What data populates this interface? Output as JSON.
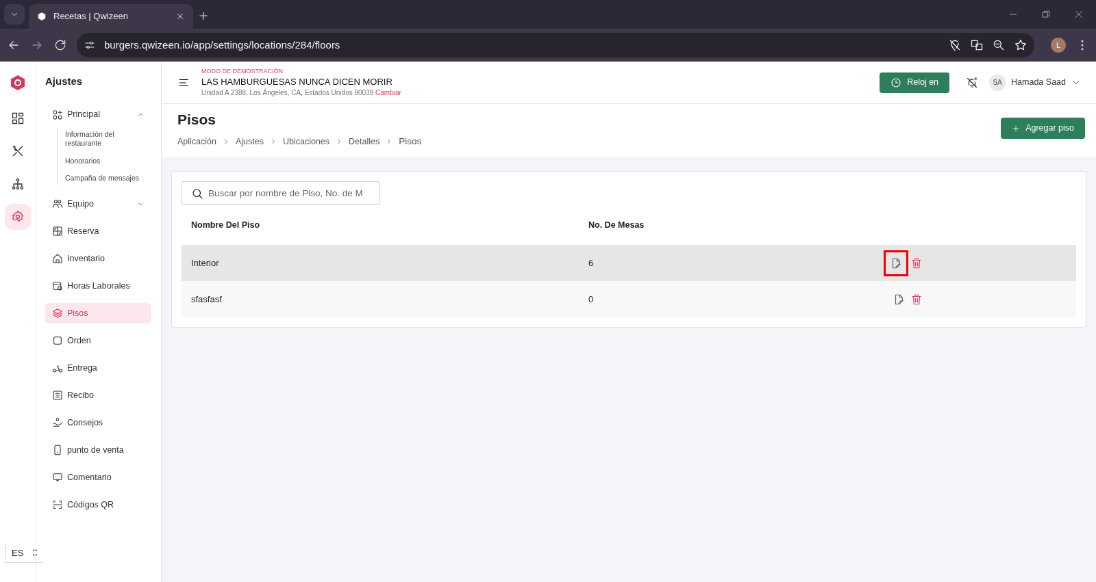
{
  "browser": {
    "tab_title": "Recetas | Qwizeen",
    "url": "burgers.qwizeen.io/app/settings/locations/284/floors",
    "profile_initial": "L"
  },
  "rail": {
    "items": [
      {
        "selected": false
      },
      {
        "selected": false
      },
      {
        "selected": false
      },
      {
        "selected": true
      }
    ],
    "language": "ES"
  },
  "sidebar": {
    "title": "Ajustes",
    "items": [
      {
        "kind": "group",
        "label": "Principal",
        "expanded": true,
        "children": [
          {
            "label": "Información del restaurante"
          },
          {
            "label": "Honorarios"
          },
          {
            "label": "Campaña de mensajes"
          }
        ]
      },
      {
        "kind": "group",
        "label": "Equipo",
        "expanded": false
      },
      {
        "kind": "item",
        "label": "Reserva",
        "selected": false
      },
      {
        "kind": "item",
        "label": "Inventario",
        "selected": false
      },
      {
        "kind": "item",
        "label": "Horas Laborales",
        "selected": false
      },
      {
        "kind": "item",
        "label": "Pisos",
        "selected": true
      },
      {
        "kind": "item",
        "label": "Orden",
        "selected": false
      },
      {
        "kind": "item",
        "label": "Entrega",
        "selected": false
      },
      {
        "kind": "item",
        "label": "Recibo",
        "selected": false
      },
      {
        "kind": "item",
        "label": "Consejos",
        "selected": false
      },
      {
        "kind": "item",
        "label": "punto de venta",
        "selected": false
      },
      {
        "kind": "item",
        "label": "Comentario",
        "selected": false
      },
      {
        "kind": "item",
        "label": "Códigos QR",
        "selected": false
      }
    ]
  },
  "header": {
    "demo_label": "MODO DE DEMOSTRACIÓN",
    "restaurant": "LAS HAMBURGUESAS NUNCA DICEN MORIR",
    "address": "Unidad A 2388, Los Ángeles, CA, Estados Unidos 90039",
    "change_link": "Cambiar",
    "clock_button": "Reloj en",
    "user_initials": "SA",
    "user_name": "Hamada Saad"
  },
  "page": {
    "title": "Pisos",
    "breadcrumbs": [
      "Aplicación",
      "Ajustes",
      "Ubicaciones",
      "Detalles",
      "Pisos"
    ],
    "add_button": "Agregar piso"
  },
  "search": {
    "placeholder": "Buscar por nombre de Piso, No. de M"
  },
  "table": {
    "columns": [
      "Nombre Del Piso",
      "No. De Mesas"
    ],
    "rows": [
      {
        "name": "Interior",
        "tables": "6",
        "hovered": true,
        "edit_highlighted": true
      },
      {
        "name": "sfasfasf",
        "tables": "0",
        "hovered": false,
        "edit_highlighted": false
      }
    ]
  }
}
